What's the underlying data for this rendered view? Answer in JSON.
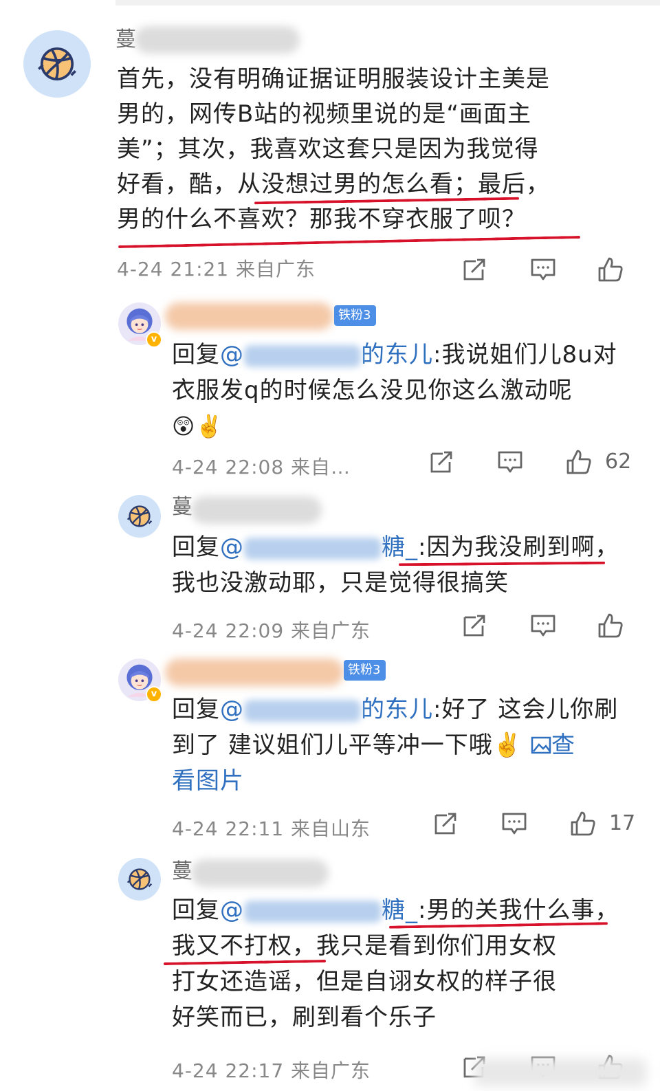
{
  "comments": [
    {
      "name_initial": "蔓",
      "text": "首先，没有明确证据证明服装设计主美是男的，网传B站的视频里说的是“画面主美”；其次，我喜欢这套只是因为我觉得好看，酷，从没想过男的怎么看；最后，男的什么不喜欢？那我不穿衣服了呗？",
      "lines": [
        "首先，没有明确证据证明服装设计主美是",
        "男的，网传B站的视频里说的是“画面主",
        "美”；其次，我喜欢这套只是因为我觉得",
        "好看，酷，从没想过男的怎么看；最后，",
        "男的什么不喜欢？那我不穿衣服了呗？"
      ],
      "meta": "4-24 21:21 来自广东"
    }
  ],
  "replies": [
    {
      "badge": "铁粉3",
      "reply_prefix": "回复",
      "mention_at": "@",
      "mention_suffix": "的东儿",
      "line1_rest": ":我说姐们儿8u对",
      "line2": "衣服发q的时候怎么没见你这么激动呢",
      "emojis": "😲✌️",
      "meta": "4-24 22:08 来自…",
      "likes": "62"
    },
    {
      "name_initial": "蔓",
      "reply_prefix": "回复",
      "mention_at": "@",
      "mention_suffix": "糖_",
      "line1_rest": ":因为我没刷到啊，",
      "line2": "我也没激动耶，只是觉得很搞笑",
      "meta": "4-24 22:09 来自广东"
    },
    {
      "badge": "铁粉3",
      "reply_prefix": "回复",
      "mention_at": "@",
      "mention_suffix": "的东儿",
      "line1_rest": ":好了  这会儿你刷",
      "line2": "到了  建议姐们儿平等冲一下哦✌️",
      "view_image_1": "查",
      "view_image_2": "看图片",
      "meta": "4-24 22:11 来自山东",
      "likes": "17"
    },
    {
      "name_initial": "蔓",
      "reply_prefix": "回复",
      "mention_at": "@",
      "mention_suffix": "糖_",
      "line1_rest": ":男的关我什么事，",
      "line2": "我又不打权，我只是看到你们用女权",
      "line3": "打女还造谣，但是自诩女权的样子很",
      "line4": "好笑而已，刷到看个乐子",
      "meta": "4-24 22:17 来自广东"
    }
  ],
  "colors": {
    "link": "#2f6fbf",
    "underline": "#d8112a",
    "meta": "#888888",
    "badge": "#4d8fe6"
  },
  "icons": [
    "share-icon",
    "comment-icon",
    "like-icon",
    "basketball-avatar-icon",
    "image-icon"
  ]
}
